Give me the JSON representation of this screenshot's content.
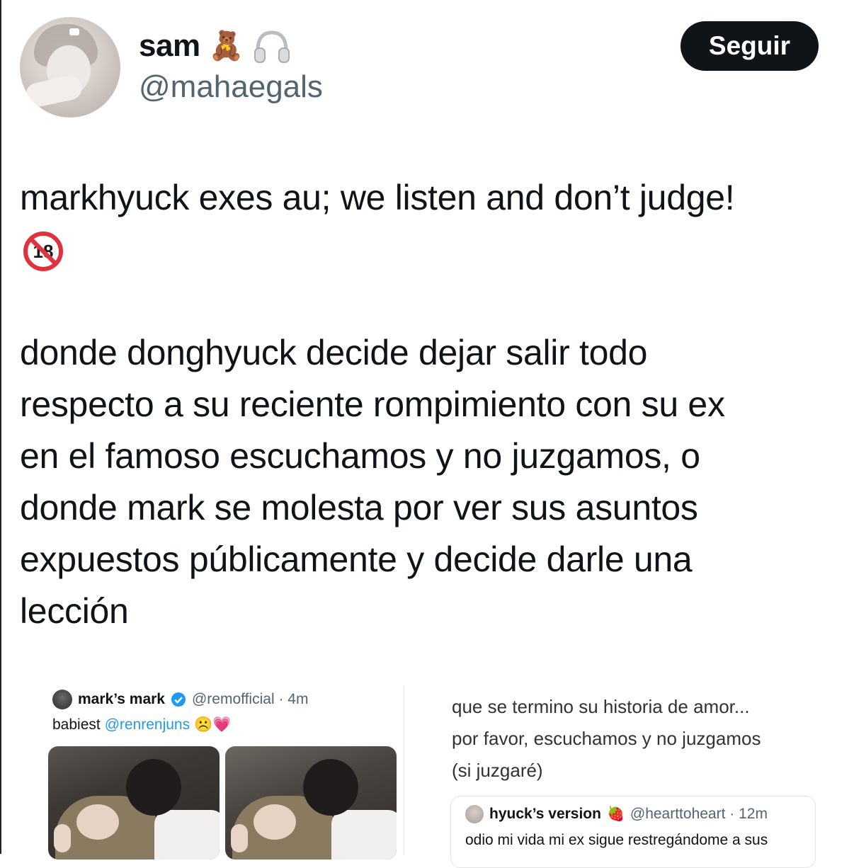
{
  "author": {
    "display_name": "sam",
    "emoji_1": "🧸",
    "handle": "@mahaegals"
  },
  "follow_button": {
    "label": "Seguir"
  },
  "tweet": {
    "line1": "markhyuck exes au; we listen and don’t judge!",
    "emoji_18": "🔞",
    "paragraph2_lines": [
      "donde donghyuck decide dejar salir todo",
      "respecto a su reciente rompimiento con su ex",
      "en el famoso escuchamos y no juzgamos, o",
      "donde mark se molesta por ver sus asuntos",
      "expuestos públicamente y decide darle una",
      "lección"
    ]
  },
  "media_left": {
    "embed_name": "mark’s mark",
    "embed_handle": "@remofficial · 4m",
    "embed_text_prefix": "babiest ",
    "embed_mention": "@renrenjuns",
    "embed_emojis": "☹️💗"
  },
  "media_right": {
    "lines": [
      "que se termino su historia de amor...",
      "por favor, escuchamos y no juzgamos",
      "(si juzgaré)"
    ],
    "quote_name": "hyuck’s version",
    "quote_emoji": "🍓",
    "quote_handle": "@hearttoheart · 12m",
    "quote_text": "odio mi vida mi ex sigue restregándome a sus"
  },
  "colors": {
    "text": "#0f1419",
    "secondary": "#536471",
    "follow_bg": "#0f1419",
    "mention": "#1d9bf0"
  }
}
